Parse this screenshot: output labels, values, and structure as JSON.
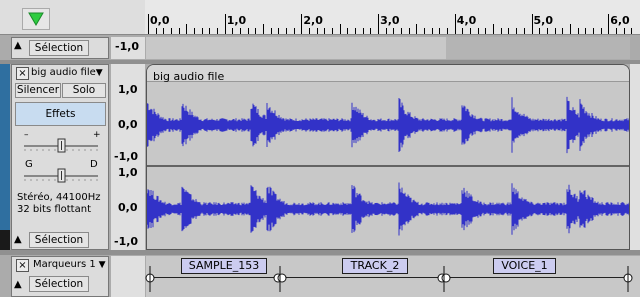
{
  "ruler": {
    "labels": [
      "0,0",
      "1,0",
      "2,0",
      "3,0",
      "4,0",
      "5,0",
      "6,0"
    ]
  },
  "top_track": {
    "select_label": "Sélection",
    "scale_label": "-1,0"
  },
  "audio_track": {
    "name": "big audio file",
    "clip_title": "big audio file",
    "mute_label": "Silencer",
    "solo_label": "Solo",
    "effects_label": "Effets",
    "gain_minus": "–",
    "gain_plus": "+",
    "pan_left": "G",
    "pan_right": "D",
    "info_line1": "Stéréo, 44100Hz",
    "info_line2": "32 bits flottant",
    "select_label": "Sélection",
    "scale_labels": [
      "1,0",
      "0,0",
      "-1,0",
      "1,0",
      "0,0",
      "-1,0"
    ]
  },
  "label_track": {
    "name": "Marqueurs 1",
    "select_label": "Sélection",
    "labels": [
      "SAMPLE_153",
      "TRACK_2",
      "VOICE_1"
    ]
  },
  "colors": {
    "waveform": "#3232c8",
    "wave_bg": "#c8c8c8",
    "play_green": "#2ecc40"
  },
  "icons": [
    "play-triangle-icon",
    "close-icon",
    "dropdown-arrow-icon",
    "gain-slider-icon",
    "pan-slider-icon",
    "collapse-arrow-icon"
  ]
}
